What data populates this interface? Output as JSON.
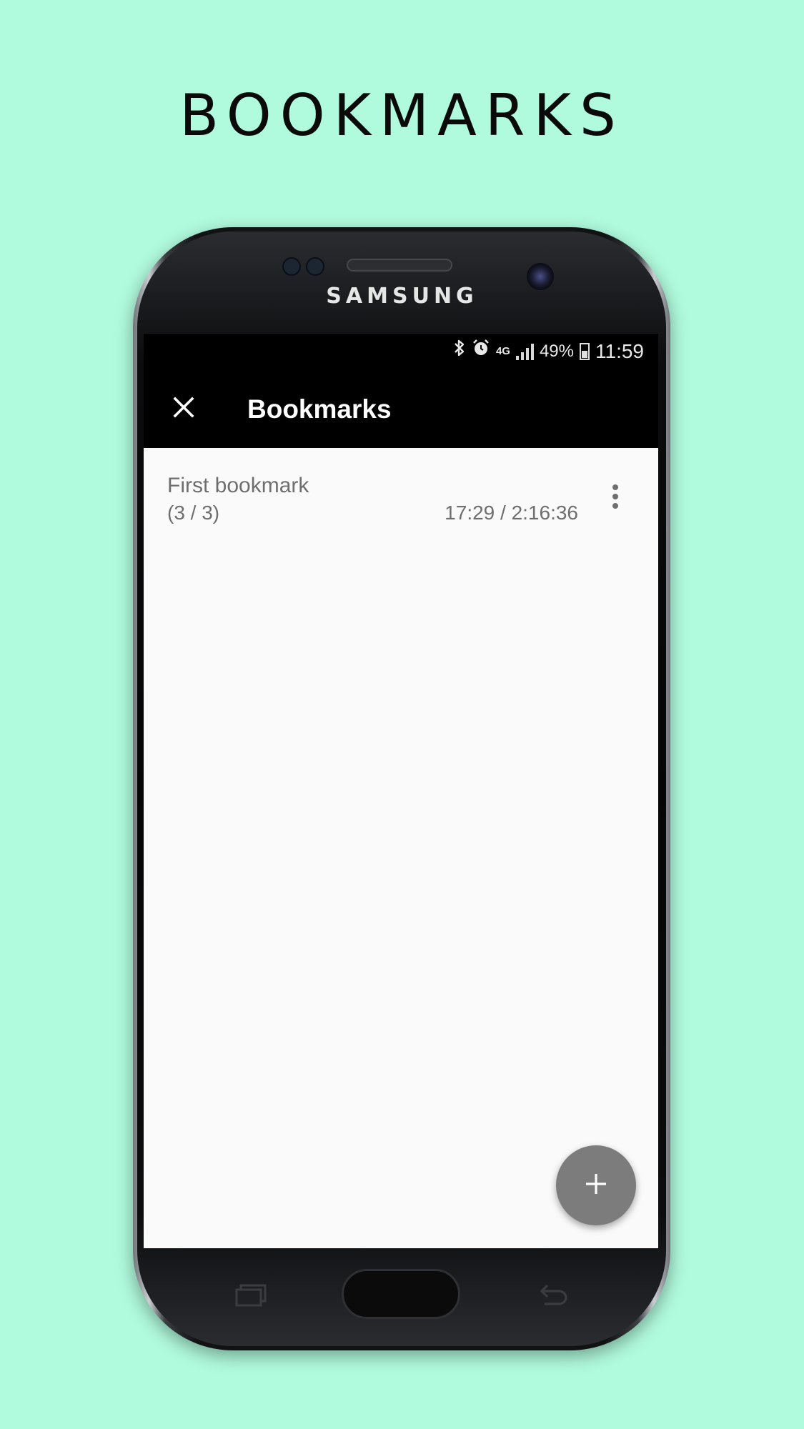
{
  "page_heading": "BOOKMARKS",
  "device": {
    "brand": "SAMSUNG"
  },
  "status_bar": {
    "network": "4G",
    "battery": "49%",
    "time": "11:59"
  },
  "toolbar": {
    "title": "Bookmarks",
    "close_icon": "close-icon"
  },
  "bookmarks": [
    {
      "title": "First bookmark",
      "count": "(3 / 3)",
      "time": "17:29 / 2:16:36",
      "menu_icon": "more-vert-icon"
    }
  ],
  "fab": {
    "icon": "plus-icon"
  },
  "colors": {
    "background": "#b0fadd",
    "toolbar": "#000000",
    "screen": "#fafafa",
    "text_secondary": "#6e6e6e",
    "fab": "#7c7c7c"
  }
}
